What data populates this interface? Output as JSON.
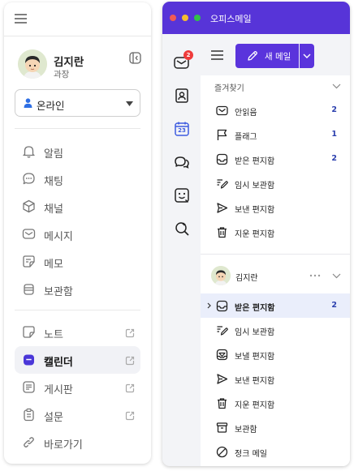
{
  "left_panel": {
    "profile": {
      "name": "김지란",
      "title": "과장"
    },
    "status": {
      "value": "온라인",
      "color": "#2f6fe4"
    },
    "nav_main": [
      {
        "id": "alerts",
        "label": "알림",
        "icon": "bell-icon"
      },
      {
        "id": "chat",
        "label": "채팅",
        "icon": "chat-bubble-icon"
      },
      {
        "id": "channel",
        "label": "채널",
        "icon": "cube-icon"
      },
      {
        "id": "messages",
        "label": "메시지",
        "icon": "envelope-icon"
      },
      {
        "id": "memo",
        "label": "메모",
        "icon": "memo-icon"
      },
      {
        "id": "archive",
        "label": "보관함",
        "icon": "archive-icon"
      }
    ],
    "nav_apps": [
      {
        "id": "note",
        "label": "노트",
        "icon": "note-icon",
        "external": true
      },
      {
        "id": "calendar",
        "label": "캘린더",
        "icon": "calendar-app-icon",
        "external": true,
        "active": true
      },
      {
        "id": "board",
        "label": "게시판",
        "icon": "board-icon",
        "external": true
      },
      {
        "id": "survey",
        "label": "설문",
        "icon": "survey-icon",
        "external": true
      },
      {
        "id": "shortcut",
        "label": "바로가기",
        "icon": "link-icon",
        "external": false
      }
    ]
  },
  "mail_window": {
    "title": "오피스메일",
    "accent_color": "#5734d8",
    "rail": [
      {
        "id": "mail",
        "icon": "mail-icon",
        "badge": "2"
      },
      {
        "id": "contacts",
        "icon": "contacts-icon"
      },
      {
        "id": "calendar",
        "icon": "calendar-icon",
        "day": "23"
      },
      {
        "id": "chat",
        "icon": "chat-icon"
      },
      {
        "id": "emoji",
        "icon": "emoji-board-icon"
      },
      {
        "id": "search",
        "icon": "search-settings-icon"
      }
    ],
    "toolbar": {
      "new_mail_label": "새 메일"
    },
    "favorites": {
      "title": "즐겨찾기",
      "folders": [
        {
          "label": "안읽음",
          "icon": "unread-envelope-icon",
          "count": "2"
        },
        {
          "label": "플래그",
          "icon": "flag-icon",
          "count": "1"
        },
        {
          "label": "받은 편지함",
          "icon": "inbox-icon",
          "count": "2"
        },
        {
          "label": "임시 보관함",
          "icon": "draft-pen-icon",
          "count": ""
        },
        {
          "label": "보낸 편지함",
          "icon": "send-icon",
          "count": ""
        },
        {
          "label": "지운 편지함",
          "icon": "trash-icon",
          "count": ""
        }
      ]
    },
    "account": {
      "name": "김지란",
      "folders": [
        {
          "label": "받은 편지함",
          "icon": "inbox-icon",
          "count": "2",
          "active": true
        },
        {
          "label": "임시 보관함",
          "icon": "draft-pen-icon",
          "count": ""
        },
        {
          "label": "보낼 편지함",
          "icon": "outbox-icon",
          "count": ""
        },
        {
          "label": "보낸 편지함",
          "icon": "send-icon",
          "count": ""
        },
        {
          "label": "지운 편지함",
          "icon": "trash-icon",
          "count": ""
        },
        {
          "label": "보관함",
          "icon": "archive-box-icon",
          "count": ""
        },
        {
          "label": "정크 메일",
          "icon": "junk-icon",
          "count": ""
        }
      ]
    }
  }
}
